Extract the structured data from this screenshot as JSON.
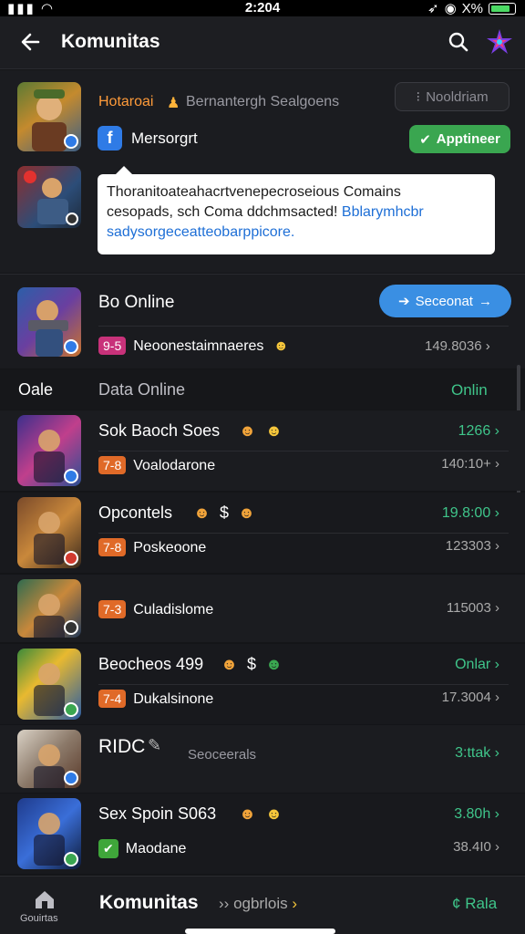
{
  "status": {
    "time": "2:204",
    "battery": "X%"
  },
  "app_bar": {
    "title": "Komunitas",
    "search_icon": "search-icon",
    "brand_icon": "brand-logo"
  },
  "header_card": {
    "game_name": "Hotaroai",
    "subtitle": "Bernantergh Sealgoens",
    "notification_button": "Nooldriam",
    "messenger_label": "Mersorgrt",
    "apply_button": "Apptineer",
    "tooltip": {
      "line1": "Thoranitoateahacrtvenepecroseious Comains",
      "line2a": "cesopads, sch Coma ddchmsacted! ",
      "line2b": "Bblarymhcbr",
      "line3": "sadysorgeceatteobarppicore."
    }
  },
  "online_block": {
    "title": "Bo Online",
    "button": "Seceonat",
    "tag": "9-5",
    "sub_label": "Neoonestaimnaeres",
    "value": "149.8036"
  },
  "section_header": {
    "left": "Oale",
    "middle": "Data Online",
    "right": "Onlin"
  },
  "games": [
    {
      "title": "Sok Baoch Soes",
      "tag": "7-8",
      "sub": "Voalodarone",
      "top_value": "1266",
      "bottom_value": "140:10+",
      "tag_color": "#e06a28",
      "top_color": "#3fc58a"
    },
    {
      "title": "Opcontels",
      "tag": "7-8",
      "sub": "Poskeoone",
      "top_value": "19.8:00",
      "bottom_value": "123303",
      "tag_color": "#e06a28",
      "top_color": "#3fc58a"
    },
    {
      "title": "",
      "tag": "7-3",
      "sub": "Culadislome",
      "top_value": "",
      "bottom_value": "115003",
      "tag_color": "#e06a28",
      "top_color": "#3fc58a"
    },
    {
      "title": "Beocheos 499",
      "tag": "7-4",
      "sub": "Dukalsinone",
      "top_value": "Onlar",
      "bottom_value": "17.3004",
      "tag_color": "#e06a28",
      "top_color": "#3fc58a"
    },
    {
      "title": "RIDC",
      "tag": "",
      "sub": "Seoceerals",
      "top_value": "3:ttak",
      "bottom_value": "",
      "tag_color": "#e06a28",
      "top_color": "#3fc58a"
    },
    {
      "title": "Sex Spoin S063",
      "tag": "",
      "sub": "Maodane",
      "top_value": "3.80h",
      "bottom_value": "38.4I0",
      "tag_color": "#3fa63a",
      "top_color": "#3fc58a"
    }
  ],
  "bottom_bar": {
    "home_label": "Gouirtas",
    "title": "Komunitas",
    "subtitle": "ogbrlois",
    "action": "Rala"
  }
}
